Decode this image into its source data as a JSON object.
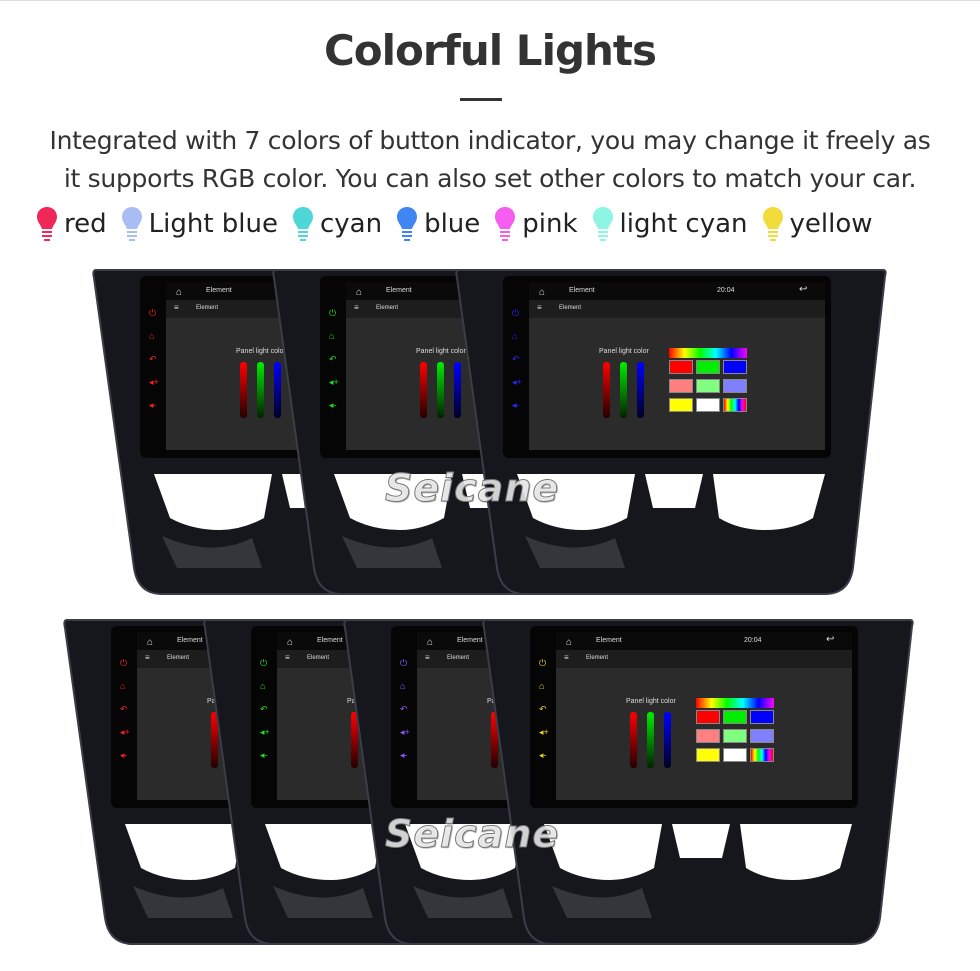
{
  "title": "Colorful Lights",
  "description_line1": "Integrated with 7 colors of button indicator, you may change it freely as",
  "description_line2": "it supports RGB color. You can also set other colors to match your car.",
  "legend": [
    {
      "label": "red",
      "color": "#f0285a"
    },
    {
      "label": "Light blue",
      "color": "#a9bdf5"
    },
    {
      "label": "cyan",
      "color": "#4fd6d6"
    },
    {
      "label": "blue",
      "color": "#3f86f2"
    },
    {
      "label": "pink",
      "color": "#f55cf0"
    },
    {
      "label": "light cyan",
      "color": "#8ef5e2"
    },
    {
      "label": "yellow",
      "color": "#f2dc3c"
    }
  ],
  "screen": {
    "app_title": "Element",
    "time": "20:04",
    "panel_label": "Panel light color"
  },
  "units": [
    {
      "button_color": "#ff2020"
    },
    {
      "button_color": "#20e020"
    },
    {
      "button_color": "#2a2aff"
    },
    {
      "button_color": "#ff2020"
    },
    {
      "button_color": "#20e020"
    },
    {
      "button_color": "#8a5cff"
    },
    {
      "button_color": "#e8d020"
    }
  ],
  "palette": [
    "#ff0000",
    "#00ee00",
    "#0000ff",
    "#ff8080",
    "#80ff80",
    "#8080ff",
    "#ffff00",
    "#ffffff",
    "rainbow"
  ],
  "watermark": "Seicane"
}
